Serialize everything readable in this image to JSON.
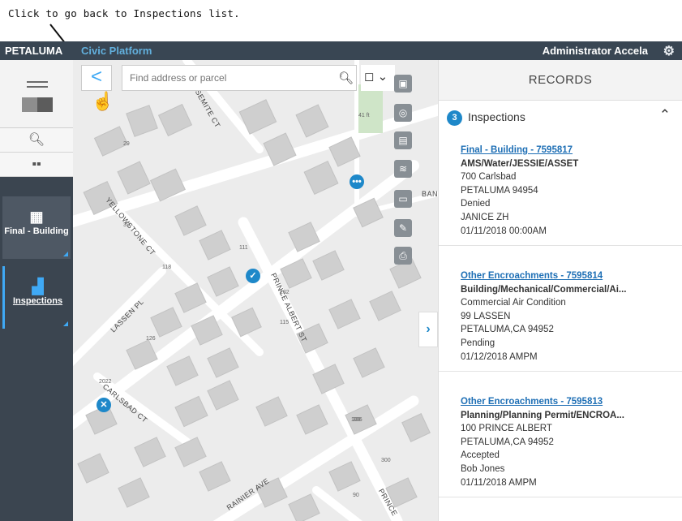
{
  "annotation": "Click to go back to Inspections list.",
  "header": {
    "brand": "PETALUMA",
    "platform": "Civic Platform",
    "user": "Administrator Accela"
  },
  "sidebar": {
    "tiles": [
      {
        "label": "Final - Building"
      },
      {
        "label": "Inspections"
      }
    ]
  },
  "map": {
    "search_placeholder": "Find address or parcel",
    "street_labels": [
      "YELLOWSTONE CT",
      "LASSEN PL",
      "CARLSBAD CT",
      "PRINCE ALBERT ST",
      "RAINIER AVE",
      "PRINCE",
      "SEMITE CT",
      "BAN"
    ],
    "house_labels": [
      "41 ft",
      "39",
      "118",
      "126",
      "2022",
      "111",
      "102",
      "115",
      "306",
      "300",
      "100",
      "90",
      "29"
    ],
    "markers": [
      {
        "type": "more",
        "color": "#1e88c9"
      },
      {
        "type": "check",
        "color": "#1e88c9"
      },
      {
        "type": "cancel",
        "color": "#1e88c9"
      }
    ]
  },
  "records": {
    "header": "RECORDS",
    "section": {
      "count": "3",
      "title": "Inspections"
    },
    "items": [
      {
        "link": "Final - Building - 7595817",
        "type": "AMS/Water/JESSIE/ASSET",
        "lines": [
          "700 Carlsbad",
          "PETALUMA 94954",
          "Denied",
          "JANICE ZH",
          "01/11/2018 00:00AM"
        ]
      },
      {
        "link": "Other Encroachments - 7595814",
        "type": "Building/Mechanical/Commercial/Ai...",
        "lines": [
          "Commercial Air Condition",
          "99 LASSEN",
          "PETALUMA,CA 94952",
          "Pending",
          "01/12/2018 AMPM"
        ]
      },
      {
        "link": "Other Encroachments - 7595813",
        "type": "Planning/Planning Permit/ENCROA...",
        "lines": [
          "100 PRINCE ALBERT",
          "PETALUMA,CA 94952",
          "Accepted",
          "Bob Jones",
          "01/11/2018 AMPM"
        ]
      }
    ]
  }
}
